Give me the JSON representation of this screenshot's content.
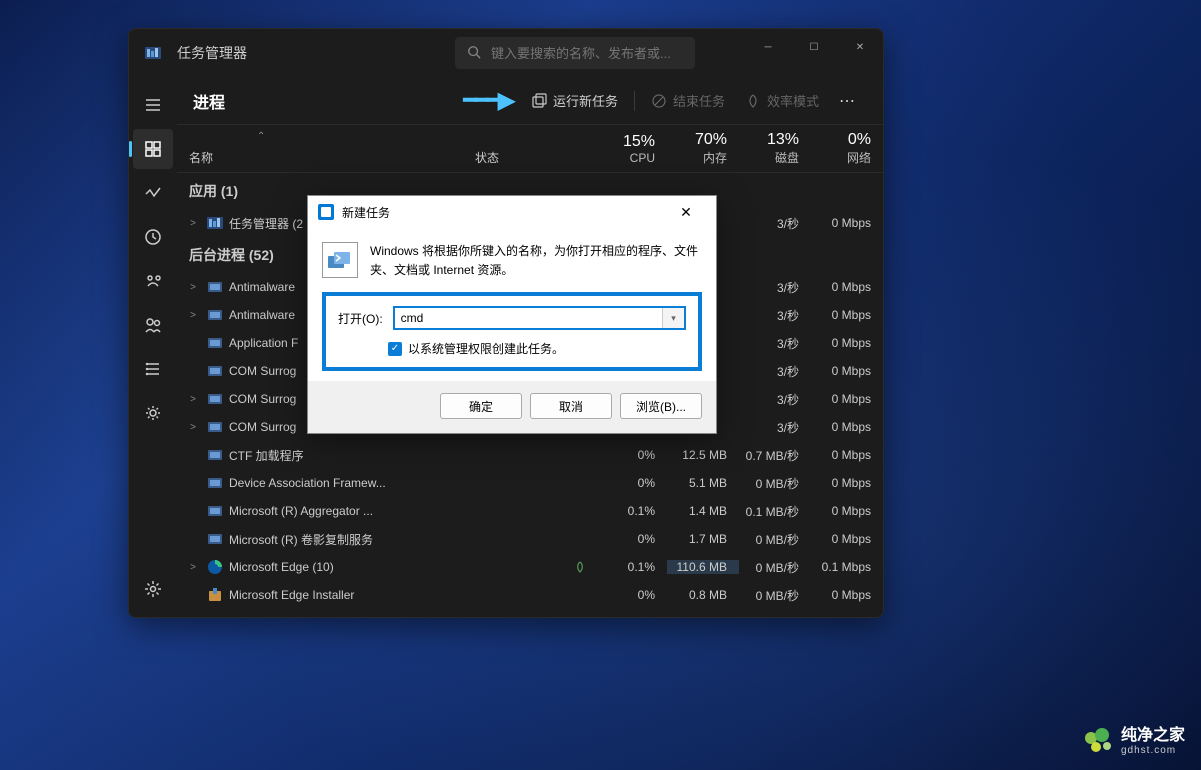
{
  "window": {
    "title": "任务管理器",
    "search_placeholder": "键入要搜索的名称、发布者或..."
  },
  "content": {
    "title": "进程",
    "run_task": "运行新任务",
    "end_task": "结束任务",
    "efficiency": "效率模式"
  },
  "columns": {
    "name": "名称",
    "status": "状态",
    "cpu_pct": "15%",
    "cpu": "CPU",
    "mem_pct": "70%",
    "mem": "内存",
    "disk_pct": "13%",
    "disk": "磁盘",
    "net_pct": "0%",
    "net": "网络"
  },
  "groups": {
    "apps": "应用 (1)",
    "bg": "后台进程 (52)"
  },
  "rows": [
    {
      "exp": ">",
      "icon": "tm",
      "name": "任务管理器 (2",
      "cpu": "",
      "mem": "",
      "disk": "3/秒",
      "net": "0 Mbps",
      "leaf": false
    },
    {
      "exp": ">",
      "icon": "app",
      "name": "Antimalware",
      "cpu": "",
      "mem": "",
      "disk": "3/秒",
      "net": "0 Mbps",
      "leaf": false
    },
    {
      "exp": ">",
      "icon": "app",
      "name": "Antimalware",
      "cpu": "",
      "mem": "",
      "disk": "3/秒",
      "net": "0 Mbps",
      "leaf": false
    },
    {
      "exp": "",
      "icon": "app",
      "name": "Application F",
      "cpu": "",
      "mem": "",
      "disk": "3/秒",
      "net": "0 Mbps",
      "leaf": false
    },
    {
      "exp": "",
      "icon": "app",
      "name": "COM Surrog",
      "cpu": "",
      "mem": "",
      "disk": "3/秒",
      "net": "0 Mbps",
      "leaf": false
    },
    {
      "exp": ">",
      "icon": "app",
      "name": "COM Surrog",
      "cpu": "",
      "mem": "",
      "disk": "3/秒",
      "net": "0 Mbps",
      "leaf": false
    },
    {
      "exp": ">",
      "icon": "app",
      "name": "COM Surrog",
      "cpu": "",
      "mem": "",
      "disk": "3/秒",
      "net": "0 Mbps",
      "leaf": false
    },
    {
      "exp": "",
      "icon": "app",
      "name": "CTF 加载程序",
      "cpu": "0%",
      "mem": "12.5 MB",
      "disk": "0.7 MB/秒",
      "net": "0 Mbps",
      "leaf": false
    },
    {
      "exp": "",
      "icon": "app",
      "name": "Device Association Framew...",
      "cpu": "0%",
      "mem": "5.1 MB",
      "disk": "0 MB/秒",
      "net": "0 Mbps",
      "leaf": false
    },
    {
      "exp": "",
      "icon": "app",
      "name": "Microsoft (R) Aggregator ...",
      "cpu": "0.1%",
      "mem": "1.4 MB",
      "disk": "0.1 MB/秒",
      "net": "0 Mbps",
      "leaf": false
    },
    {
      "exp": "",
      "icon": "app",
      "name": "Microsoft (R) 卷影复制服务",
      "cpu": "0%",
      "mem": "1.7 MB",
      "disk": "0 MB/秒",
      "net": "0 Mbps",
      "leaf": false
    },
    {
      "exp": ">",
      "icon": "edge",
      "name": "Microsoft Edge (10)",
      "cpu": "0.1%",
      "mem": "110.6 MB",
      "disk": "0 MB/秒",
      "net": "0.1 Mbps",
      "leaf": true,
      "mem_hl": true
    },
    {
      "exp": "",
      "icon": "inst",
      "name": "Microsoft Edge Installer",
      "cpu": "0%",
      "mem": "0.8 MB",
      "disk": "0 MB/秒",
      "net": "0 Mbps",
      "leaf": false
    }
  ],
  "dialog": {
    "title": "新建任务",
    "message": "Windows 将根据你所键入的名称，为你打开相应的程序、文件夹、文档或 Internet 资源。",
    "open_label": "打开(O):",
    "input_value": "cmd",
    "admin_check": "以系统管理权限创建此任务。",
    "ok": "确定",
    "cancel": "取消",
    "browse": "浏览(B)..."
  },
  "watermark": {
    "main": "纯净之家",
    "sub": "gdhst.com"
  }
}
